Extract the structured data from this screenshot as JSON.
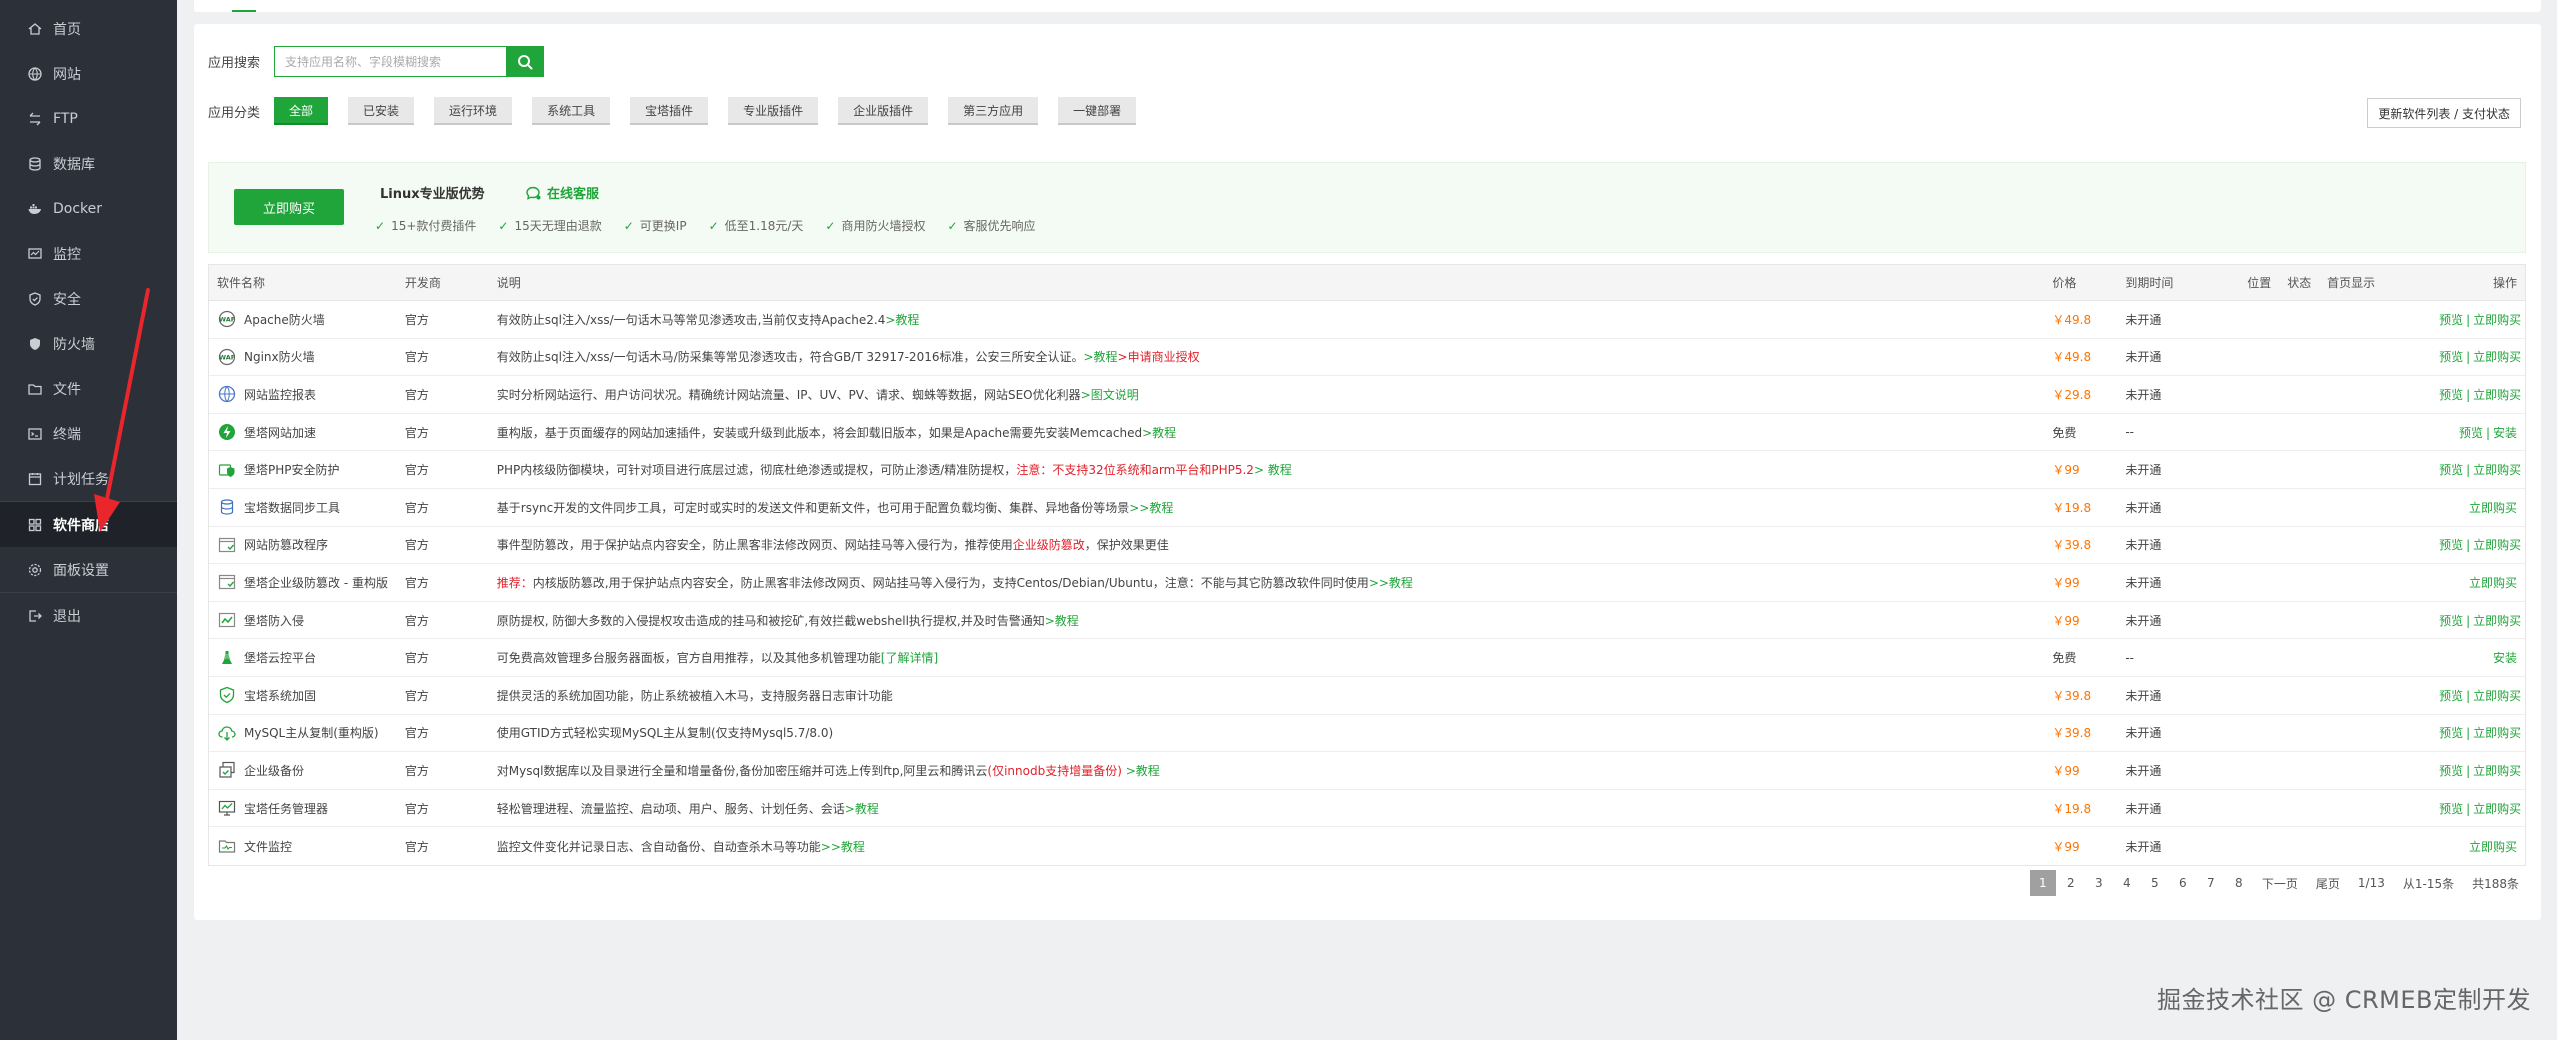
{
  "sidebar": {
    "items": [
      {
        "label": "首页",
        "icon": "home-icon"
      },
      {
        "label": "网站",
        "icon": "globe-icon"
      },
      {
        "label": "FTP",
        "icon": "ftp-icon"
      },
      {
        "label": "数据库",
        "icon": "database-icon"
      },
      {
        "label": "Docker",
        "icon": "docker-icon"
      },
      {
        "label": "监控",
        "icon": "monitor-icon"
      },
      {
        "label": "安全",
        "icon": "shield-icon"
      },
      {
        "label": "防火墙",
        "icon": "firewall-icon"
      },
      {
        "label": "文件",
        "icon": "folder-icon"
      },
      {
        "label": "终端",
        "icon": "terminal-icon"
      },
      {
        "label": "计划任务",
        "icon": "clock-icon"
      },
      {
        "label": "软件商店",
        "icon": "grid-icon",
        "active": true
      },
      {
        "label": "面板设置",
        "icon": "gear-icon"
      },
      {
        "label": "退出",
        "icon": "logout-icon"
      }
    ]
  },
  "search": {
    "label": "应用搜索",
    "placeholder": "支持应用名称、字段模糊搜索"
  },
  "category": {
    "label": "应用分类",
    "items": [
      "全部",
      "已安装",
      "运行环境",
      "系统工具",
      "宝塔插件",
      "专业版插件",
      "企业版插件",
      "第三方应用",
      "一键部署"
    ],
    "active": 0
  },
  "update_button": "更新软件列表 / 支付状态",
  "promo": {
    "buy_label": "立即购买",
    "title": "Linux专业版优势",
    "service_label": "在线客服",
    "features": [
      "15+款付费插件",
      "15天无理由退款",
      "可更换IP",
      "低至1.18元/天",
      "商用防火墙授权",
      "客服优先响应"
    ]
  },
  "table": {
    "headers": {
      "name": "软件名称",
      "dev": "开发商",
      "desc": "说明",
      "price": "价格",
      "expire": "到期时间",
      "pos": "位置",
      "status": "状态",
      "home": "首页显示",
      "op": "操作"
    },
    "rows": [
      {
        "icon": "waf-icon",
        "name": "Apache防火墙",
        "dev": "官方",
        "desc": "有效防止sql注入/xss/一句话木马等常见渗透攻击,当前仅支持Apache2.4",
        "desc_link": ">教程",
        "price": "￥49.8",
        "expire": "未开通",
        "ops": [
          "预览",
          "立即购买"
        ]
      },
      {
        "icon": "waf-icon",
        "name": "Nginx防火墙",
        "dev": "官方",
        "desc": "有效防止sql注入/xss/一句话木马/防采集等常见渗透攻击，符合GB/T 32917-2016标准，公安三所安全认证。",
        "desc_link": ">教程",
        "desc_warn": ">申请商业授权",
        "price": "￥49.8",
        "expire": "未开通",
        "ops": [
          "预览",
          "立即购买"
        ]
      },
      {
        "icon": "report-icon",
        "name": "网站监控报表",
        "dev": "官方",
        "desc": "实时分析网站运行、用户访问状况。精确统计网站流量、IP、UV、PV、请求、蜘蛛等数据，网站SEO优化利器",
        "desc_link": ">图文说明",
        "price": "￥29.8",
        "expire": "未开通",
        "ops": [
          "预览",
          "立即购买"
        ]
      },
      {
        "icon": "speed-icon",
        "name": "堡塔网站加速",
        "dev": "官方",
        "desc": "重构版，基于页面缓存的网站加速插件，安装或升级到此版本，将会卸载旧版本，如果是Apache需要先安装Memcached",
        "desc_link": ">教程",
        "price": "免费",
        "expire": "--",
        "ops": [
          "预览",
          "安装"
        ]
      },
      {
        "icon": "php-shield-icon",
        "name": "堡塔PHP安全防护",
        "dev": "官方",
        "desc": "PHP内核级防御模块，可针对项目进行底层过滤，彻底杜绝渗透或提权，可防止渗透/精准防提权，",
        "desc_warn": "注意：不支持32位系统和arm平台和PHP5.2",
        "desc_link": "> 教程",
        "price": "￥99",
        "expire": "未开通",
        "ops": [
          "预览",
          "立即购买"
        ]
      },
      {
        "icon": "sync-icon",
        "name": "宝塔数据同步工具",
        "dev": "官方",
        "desc": "基于rsync开发的文件同步工具，可定时或实时的发送文件和更新文件，也可用于配置负载均衡、集群、异地备份等场景",
        "desc_link": ">>教程",
        "price": "￥19.8",
        "expire": "未开通",
        "ops": [
          "立即购买"
        ]
      },
      {
        "icon": "tamper-icon",
        "name": "网站防篡改程序",
        "dev": "官方",
        "desc": "事件型防篡改，用于保护站点内容安全，防止黑客非法修改网页、网站挂马等入侵行为，推荐使用",
        "desc_warn": "企业级防篡改",
        "desc_tail": "，保护效果更佳",
        "price": "￥39.8",
        "expire": "未开通",
        "ops": [
          "预览",
          "立即购买"
        ]
      },
      {
        "icon": "tamper-icon",
        "name": "堡塔企业级防篡改 - 重构版",
        "dev": "官方",
        "desc_prefix_warn": "推荐：",
        "desc": "内核版防篡改,用于保护站点内容安全，防止黑客非法修改网页、网站挂马等入侵行为，支持Centos/Debian/Ubuntu，注意：不能与其它防篡改软件同时使用",
        "desc_link": ">>教程",
        "price": "￥99",
        "expire": "未开通",
        "ops": [
          "立即购买"
        ]
      },
      {
        "icon": "intrusion-icon",
        "name": "堡塔防入侵",
        "dev": "官方",
        "desc": "原防提权, 防御大多数的入侵提权攻击造成的挂马和被挖矿,有效拦截webshell执行提权,并及时告警通知",
        "desc_link": ">教程",
        "price": "￥99",
        "expire": "未开通",
        "ops": [
          "预览",
          "立即购买"
        ]
      },
      {
        "icon": "cloud-icon",
        "name": "堡塔云控平台",
        "dev": "官方",
        "desc": "可免费高效管理多台服务器面板，官方自用推荐，以及其他多机管理功能",
        "desc_link": "[了解详情]",
        "price": "免费",
        "expire": "--",
        "ops": [
          "安装"
        ]
      },
      {
        "icon": "harden-icon",
        "name": "宝塔系统加固",
        "dev": "官方",
        "desc": "提供灵活的系统加固功能，防止系统被植入木马，支持服务器日志审计功能",
        "price": "￥39.8",
        "expire": "未开通",
        "ops": [
          "预览",
          "立即购买"
        ]
      },
      {
        "icon": "mysql-icon",
        "name": "MySQL主从复制(重构版)",
        "dev": "官方",
        "desc": "使用GTID方式轻松实现MySQL主从复制(仅支持Mysql5.7/8.0)",
        "price": "￥39.8",
        "expire": "未开通",
        "ops": [
          "预览",
          "立即购买"
        ]
      },
      {
        "icon": "backup-icon",
        "name": "企业级备份",
        "dev": "官方",
        "desc": "对Mysql数据库以及目录进行全量和增量备份,备份加密压缩并可选上传到ftp,阿里云和腾讯云",
        "desc_warn": "(仅innodb支持增量备份)",
        "desc_link": " >教程",
        "price": "￥99",
        "expire": "未开通",
        "ops": [
          "预览",
          "立即购买"
        ]
      },
      {
        "icon": "task-icon",
        "name": "宝塔任务管理器",
        "dev": "官方",
        "desc": "轻松管理进程、流量监控、启动项、用户、服务、计划任务、会话",
        "desc_link": ">教程",
        "price": "￥19.8",
        "expire": "未开通",
        "ops": [
          "预览",
          "立即购买"
        ]
      },
      {
        "icon": "file-monitor-icon",
        "name": "文件监控",
        "dev": "官方",
        "desc": "监控文件变化并记录日志、含自动备份、自动查杀木马等功能",
        "desc_link": ">>教程",
        "price": "￥99",
        "expire": "未开通",
        "ops": [
          "立即购买"
        ]
      }
    ]
  },
  "pagination": {
    "pages": [
      "1",
      "2",
      "3",
      "4",
      "5",
      "6",
      "7",
      "8"
    ],
    "active": "1",
    "next": "下一页",
    "last": "尾页",
    "page_info": "1/13",
    "range": "从1-15条",
    "total": "共188条"
  },
  "watermark": "掘金技术社区 @ CRMEB定制开发",
  "colors": {
    "accent": "#20a53a",
    "price": "#ff7300",
    "warn": "#e0212a",
    "sidebar_bg": "#2c3038",
    "annotation_arrow": "#e8262b"
  }
}
